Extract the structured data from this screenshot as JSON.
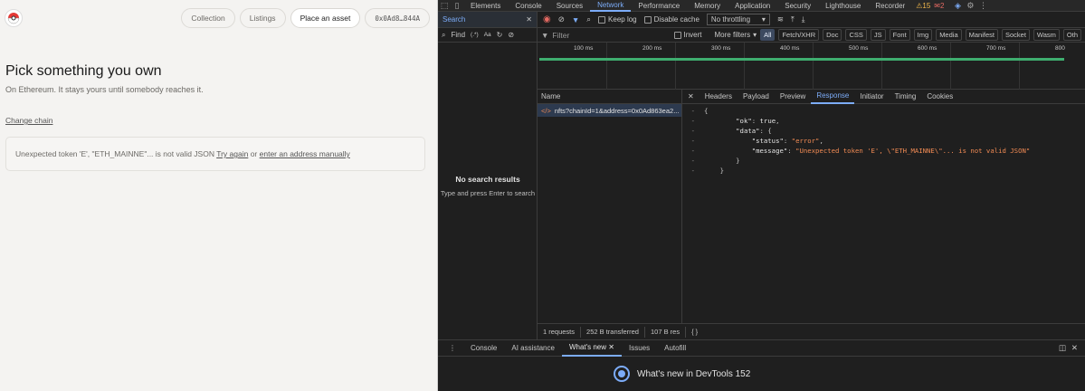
{
  "app": {
    "nav": {
      "collection": "Collection",
      "listings": "Listings",
      "place_asset": "Place an asset",
      "address": "0x0Ad8…844A"
    },
    "heading": "Pick something you own",
    "subheading": "On Ethereum. It stays yours until somebody reaches it.",
    "change_chain": "Change chain",
    "error": {
      "message": "Unexpected token 'E', \"ETH_MAINNE\"... is not valid JSON",
      "retry": "Try again",
      "or": "or",
      "manual": "enter an address manually"
    }
  },
  "devtools": {
    "tabs": [
      "Elements",
      "Console",
      "Sources",
      "Network",
      "Performance",
      "Memory",
      "Application",
      "Security",
      "Lighthouse",
      "Recorder"
    ],
    "active_tab": "Network",
    "warnings": "15",
    "errors": "2",
    "search": {
      "title": "Search",
      "find": "Find",
      "regex": "(.*)",
      "case": "Aa",
      "empty_title": "No search results",
      "empty_hint": "Type and press Enter to search"
    },
    "toolbar": {
      "preserve_log": "Keep log",
      "disable_cache": "Disable cache",
      "throttling": "No throttling",
      "filter_placeholder": "Filter",
      "invert": "Invert",
      "more_filters": "More filters"
    },
    "filter_chips": [
      "All",
      "Fetch/XHR",
      "Doc",
      "CSS",
      "JS",
      "Font",
      "Img",
      "Media",
      "Manifest",
      "Socket",
      "Wasm",
      "Oth"
    ],
    "timeline_ticks": [
      "100 ms",
      "200 ms",
      "300 ms",
      "400 ms",
      "500 ms",
      "600 ms",
      "700 ms",
      "800"
    ],
    "list": {
      "header": "Name",
      "request": "nfts?chainId=1&address=0x0Ad863ea2..."
    },
    "detail_tabs": [
      "Headers",
      "Payload",
      "Preview",
      "Response",
      "Initiator",
      "Timing",
      "Cookies"
    ],
    "detail_active": "Response",
    "response_lines": [
      {
        "k": "\"ok\"",
        "v": "true"
      },
      {
        "k": "\"data\"",
        "v": "{"
      },
      {
        "k": "\"status\"",
        "v": "\"error\""
      },
      {
        "k": "\"message\"",
        "v": "\"Unexpected token 'E', \\\"ETH_MAINNE\\\"... is not valid JSON\""
      }
    ],
    "status": {
      "requests": "1 requests",
      "transferred": "252 B transferred",
      "resources": "107 B res"
    },
    "drawer": {
      "tabs": [
        "Console",
        "AI assistance",
        "What's new",
        "Issues",
        "Autofill"
      ],
      "active": "What's new",
      "banner": "What's new in DevTools 152"
    }
  }
}
